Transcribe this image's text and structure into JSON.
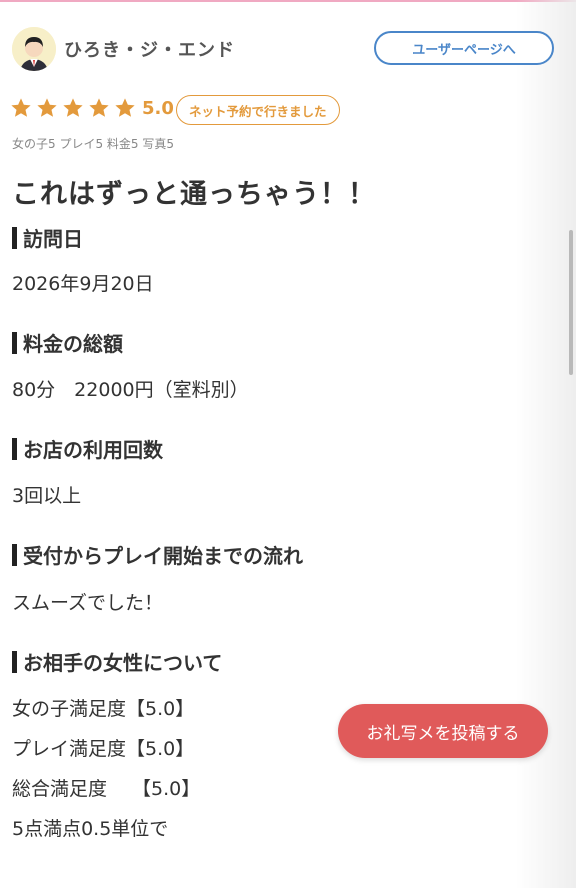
{
  "reviewer": {
    "name": "ひろき・ジ・エンド",
    "avatar_bg": "#f7efc8"
  },
  "user_page_button": "ユーザーページへ",
  "rating": {
    "stars": 5,
    "max_stars": 5,
    "score": "5.0",
    "star_color": "#e39a3c"
  },
  "badge": "ネット予約で行きました",
  "subscores": "女の子5 プレイ5 料金5 写真5",
  "review_title": "これはずっと通っちゃう！！",
  "sections": [
    {
      "heading": "訪問日",
      "body": "2026年9月20日"
    },
    {
      "heading": "料金の総額",
      "body": "80分　22000円（室料別）"
    },
    {
      "heading": "お店の利用回数",
      "body": "3回以上"
    },
    {
      "heading": "受付からプレイ開始までの流れ",
      "body": "スムーズでした！"
    },
    {
      "heading": "お相手の女性について",
      "lines": [
        "女の子満足度【5.0】",
        "プレイ満足度【5.0】",
        "総合満足度　 【5.0】",
        "5点満点0.5単位で"
      ]
    }
  ],
  "fab_button": "お礼写メを投稿する",
  "colors": {
    "accent_blue": "#4a86c9",
    "fab_red": "#e05a5a",
    "top_line_pink": "#f0a9c2"
  }
}
